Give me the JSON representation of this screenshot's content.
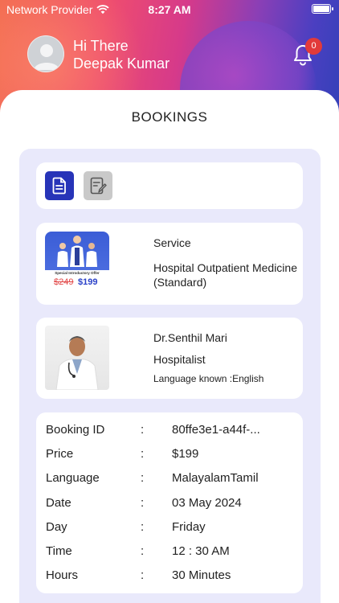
{
  "status_bar": {
    "carrier": "Network Provider",
    "time": "8:27 AM"
  },
  "header": {
    "greeting": "Hi There",
    "user_name": "Deepak Kumar",
    "notification_count": "0"
  },
  "page": {
    "title": "BOOKINGS"
  },
  "tabs": [
    {
      "icon": "document-icon",
      "active": true
    },
    {
      "icon": "edit-note-icon",
      "active": false
    }
  ],
  "service": {
    "label": "Service",
    "name": "Hospital Outpatient Medicine (Standard)",
    "promo_text": "Special Introductory Offer",
    "old_price": "$249",
    "new_price": "$199"
  },
  "doctor": {
    "name": "Dr.Senthil Mari",
    "role": "Hospitalist",
    "languages": "Language known :English"
  },
  "details": [
    {
      "key": "Booking ID",
      "sep": ":",
      "value": "80ffe3e1-a44f-..."
    },
    {
      "key": "Price",
      "sep": ":",
      "value": "$199"
    },
    {
      "key": "Language",
      "sep": ":",
      "value": "MalayalamTamil"
    },
    {
      "key": "Date",
      "sep": ":",
      "value": "03 May 2024"
    },
    {
      "key": "Day",
      "sep": ":",
      "value": "Friday"
    },
    {
      "key": "Time",
      "sep": ":",
      "value": "12 : 30 AM"
    },
    {
      "key": "Hours",
      "sep": ":",
      "value": "30 Minutes"
    }
  ],
  "colors": {
    "accent": "#2734b8",
    "panel": "#e9e9fb",
    "badge": "#e23a3a",
    "old_price": "#e24848"
  }
}
